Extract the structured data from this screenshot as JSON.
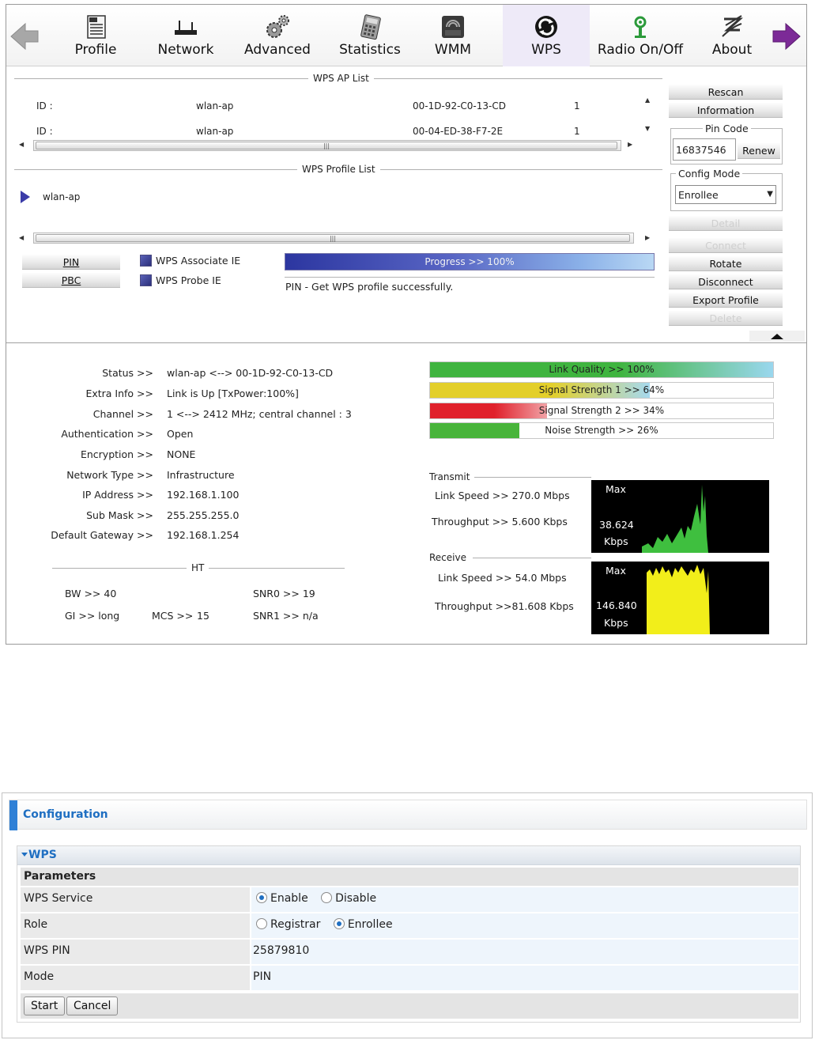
{
  "toolbar": {
    "items": [
      {
        "label": "Profile",
        "icon": "profile-icon"
      },
      {
        "label": "Network",
        "icon": "network-icon"
      },
      {
        "label": "Advanced",
        "icon": "advanced-gears-icon"
      },
      {
        "label": "Statistics",
        "icon": "statistics-calculator-icon"
      },
      {
        "label": "WMM",
        "icon": "wmm-qos-icon"
      },
      {
        "label": "WPS",
        "icon": "wps-icon"
      },
      {
        "label": "Radio On/Off",
        "icon": "radio-icon"
      },
      {
        "label": "About",
        "icon": "about-icon"
      }
    ],
    "active": "WPS",
    "back_icon": "back-arrow-icon",
    "forward_icon": "forward-arrow-icon"
  },
  "ap_list": {
    "title": "WPS AP List",
    "rows": [
      {
        "id_label": "ID :",
        "ssid": "wlan-ap",
        "bssid": "00-1D-92-C0-13-CD",
        "channel": "1"
      },
      {
        "id_label": "ID :",
        "ssid": "wlan-ap",
        "bssid": "00-04-ED-38-F7-2E",
        "channel": "1"
      }
    ]
  },
  "profile_list": {
    "title": "WPS Profile List",
    "items": [
      "wlan-ap"
    ]
  },
  "wps_controls": {
    "pin_button": "PIN",
    "pbc_button": "PBC",
    "associate_ie": "WPS Associate IE",
    "probe_ie": "WPS Probe IE",
    "progress_label": "Progress >> 100%",
    "progress_value": 100,
    "message": "PIN - Get WPS profile successfully."
  },
  "side_buttons": {
    "rescan": "Rescan",
    "information": "Information",
    "pin_code_legend": "Pin Code",
    "pin_code_value": "16837546",
    "renew": "Renew",
    "config_mode_legend": "Config Mode",
    "config_mode_value": "Enrollee",
    "detail": "Detail",
    "connect": "Connect",
    "rotate": "Rotate",
    "disconnect": "Disconnect",
    "export_profile": "Export Profile",
    "delete": "Delete"
  },
  "status": {
    "rows": [
      {
        "label": "Status >>",
        "value": "wlan-ap <--> 00-1D-92-C0-13-CD"
      },
      {
        "label": "Extra Info >>",
        "value": "Link is Up [TxPower:100%]"
      },
      {
        "label": "Channel >>",
        "value": "1 <--> 2412 MHz; central channel : 3"
      },
      {
        "label": "Authentication >>",
        "value": "Open"
      },
      {
        "label": "Encryption >>",
        "value": "NONE"
      },
      {
        "label": "Network Type >>",
        "value": "Infrastructure"
      },
      {
        "label": "IP Address >>",
        "value": "192.168.1.100"
      },
      {
        "label": "Sub Mask >>",
        "value": "255.255.255.0"
      },
      {
        "label": "Default Gateway >>",
        "value": "192.168.1.254"
      }
    ]
  },
  "ht": {
    "title": "HT",
    "bw": "BW >> 40",
    "gi": "GI >> long",
    "mcs_label": "MCS >>",
    "mcs_value": "15",
    "snr0": "SNR0 >>  19",
    "snr1": "SNR1 >>  n/a"
  },
  "meters": [
    {
      "label": "Link Quality >> 100%",
      "value": 100,
      "color_a": "#3fb43f",
      "color_b": "#9ad7ee"
    },
    {
      "label": "Signal Strength 1 >> 64%",
      "value": 64,
      "color_a": "#e3cf2a",
      "color_b": "#a6d9ef"
    },
    {
      "label": "Signal Strength 2 >> 34%",
      "value": 34,
      "color_a": "#e0212b",
      "color_b": "#f1a2a6"
    },
    {
      "label": "Noise Strength >> 26%",
      "value": 26,
      "color_a": "#48b43a",
      "color_b": "#48b43a"
    }
  ],
  "transmit": {
    "title": "Transmit",
    "link_speed": "Link Speed >>  270.0 Mbps",
    "throughput": "Throughput >> 5.600 Kbps",
    "graph_max": "Max",
    "graph_value": "38.624",
    "graph_unit": "Kbps",
    "graph_color": "#3fbf3f"
  },
  "receive": {
    "title": "Receive",
    "link_speed": "Link Speed >> 54.0 Mbps",
    "throughput": "Throughput >>81.608 Kbps",
    "graph_max": "Max",
    "graph_value": "146.840",
    "graph_unit": "Kbps",
    "graph_color": "#f2ee1a"
  },
  "config": {
    "header": "Configuration",
    "section": "WPS",
    "parameters": "Parameters",
    "rows": [
      {
        "key": "WPS Service",
        "options": [
          {
            "label": "Enable",
            "selected": true
          },
          {
            "label": "Disable",
            "selected": false
          }
        ]
      },
      {
        "key": "Role",
        "options": [
          {
            "label": "Registrar",
            "selected": false
          },
          {
            "label": "Enrollee",
            "selected": true
          }
        ]
      },
      {
        "key": "WPS PIN",
        "value": "25879810"
      },
      {
        "key": "Mode",
        "value": "PIN"
      }
    ],
    "start": "Start",
    "cancel": "Cancel",
    "accent": "#1f6fc2"
  }
}
